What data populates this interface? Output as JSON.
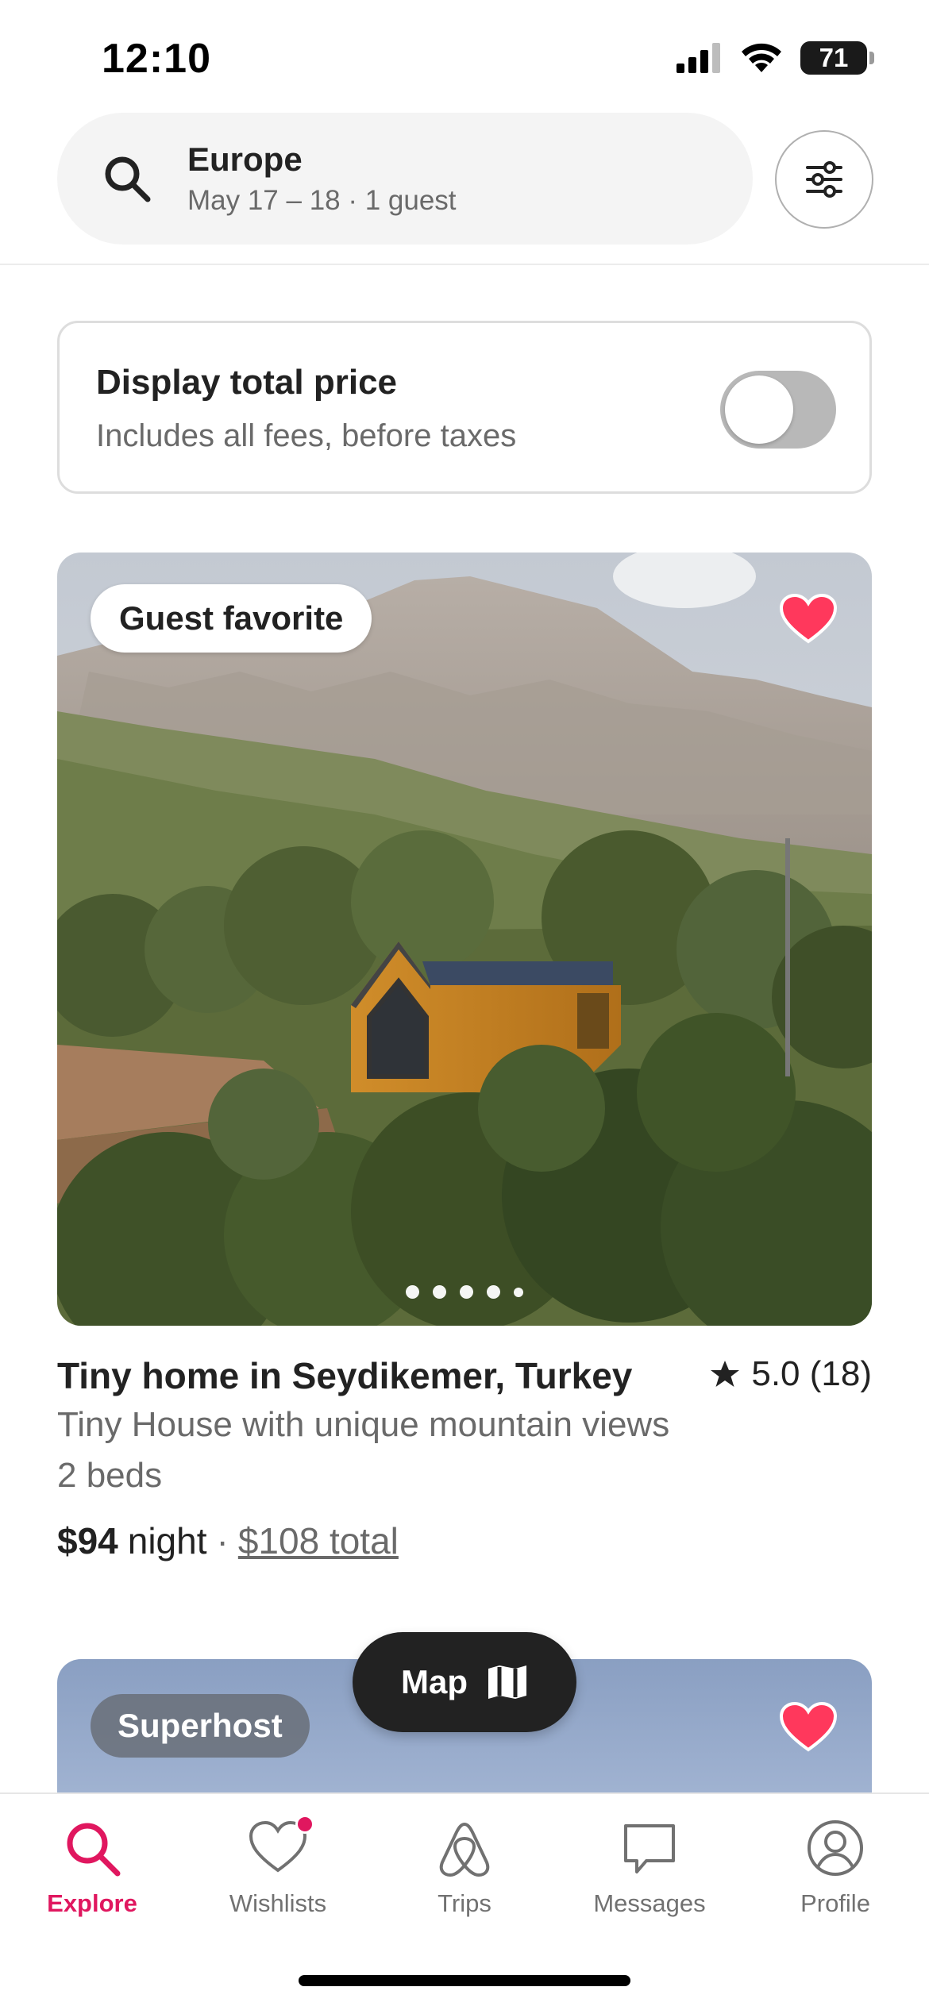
{
  "status_bar": {
    "time": "12:10",
    "battery": "71"
  },
  "search": {
    "location": "Europe",
    "details": "May 17 – 18 · 1 guest"
  },
  "price_toggle": {
    "title": "Display total price",
    "subtitle": "Includes all fees, before taxes",
    "enabled": false
  },
  "listing": {
    "badge": "Guest favorite",
    "title": "Tiny home in Seydikemer, Turkey",
    "rating": "5.0 (18)",
    "description": "Tiny House with unique mountain views",
    "beds": "2 beds",
    "price": "$94",
    "price_unit": "night",
    "separator": "·",
    "total": "$108 total",
    "saved": true,
    "photo_count": 5,
    "photo_index": 1
  },
  "next_listing": {
    "badge": "Superhost",
    "saved": true
  },
  "map_button": {
    "label": "Map"
  },
  "tabs": [
    {
      "label": "Explore",
      "icon": "search-icon",
      "active": true
    },
    {
      "label": "Wishlists",
      "icon": "heart-icon",
      "active": false,
      "has_notification": true
    },
    {
      "label": "Trips",
      "icon": "airbnb-logo-icon",
      "active": false
    },
    {
      "label": "Messages",
      "icon": "message-icon",
      "active": false
    },
    {
      "label": "Profile",
      "icon": "profile-icon",
      "active": false
    }
  ],
  "colors": {
    "accent": "#e0175f",
    "heart": "#ff385c",
    "text": "#222222",
    "muted": "#6a6a6a"
  }
}
